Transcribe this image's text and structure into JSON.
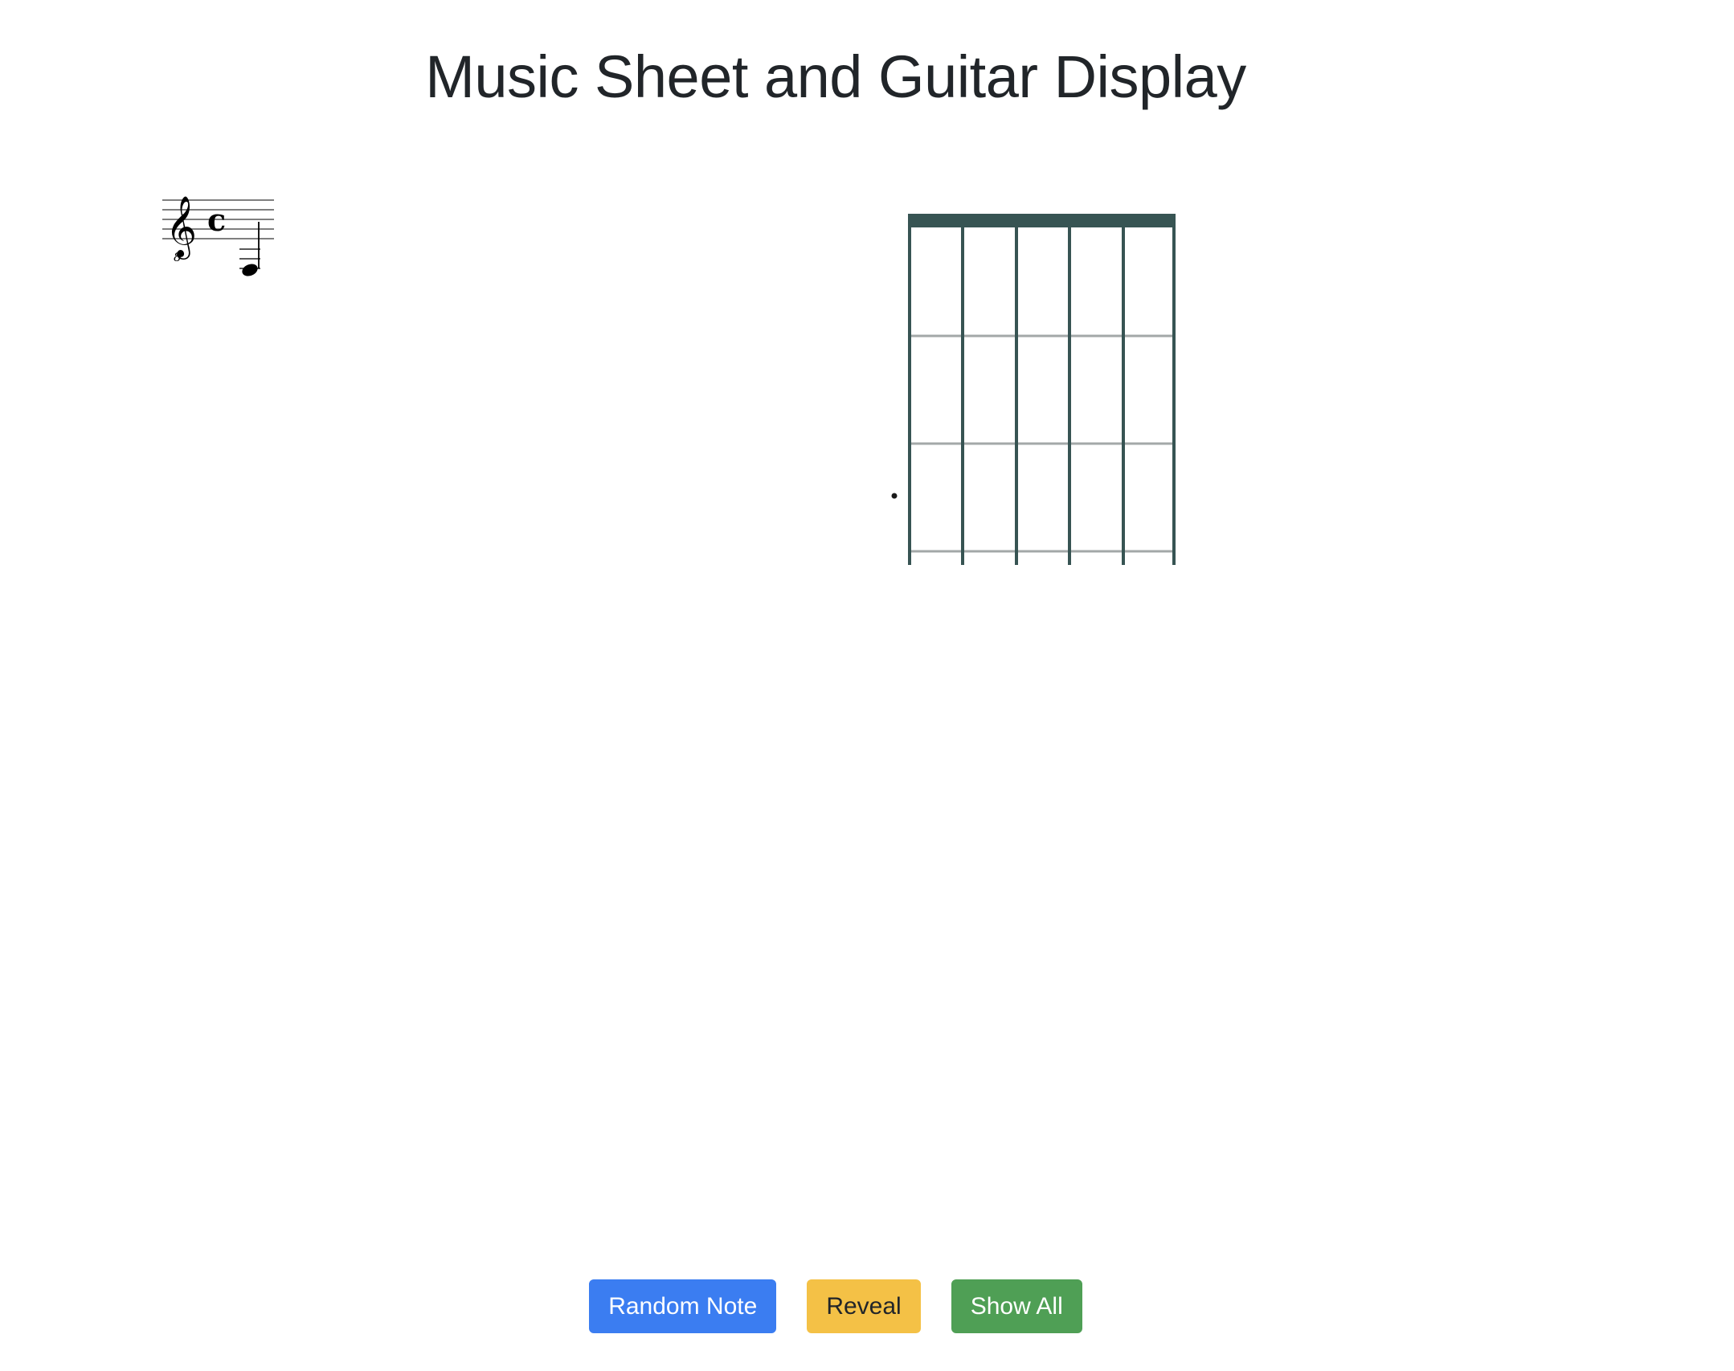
{
  "page": {
    "title": "Music Sheet and Guitar Display"
  },
  "music_sheet": {
    "clef": "treble-8vb",
    "time_signature": "c",
    "note": "whole-note-below-staff"
  },
  "fretboard": {
    "strings": 6,
    "frets_visible": 3,
    "colors": {
      "nut": "#375453",
      "strings": "#375453",
      "frets": "#a3a8a8",
      "marker": "#1a1a1a"
    }
  },
  "buttons": {
    "random_note": "Random Note",
    "reveal": "Reveal",
    "show_all": "Show All"
  },
  "colors": {
    "primary": "#3b7df1",
    "warning": "#f4c146",
    "success": "#4f9f55"
  }
}
